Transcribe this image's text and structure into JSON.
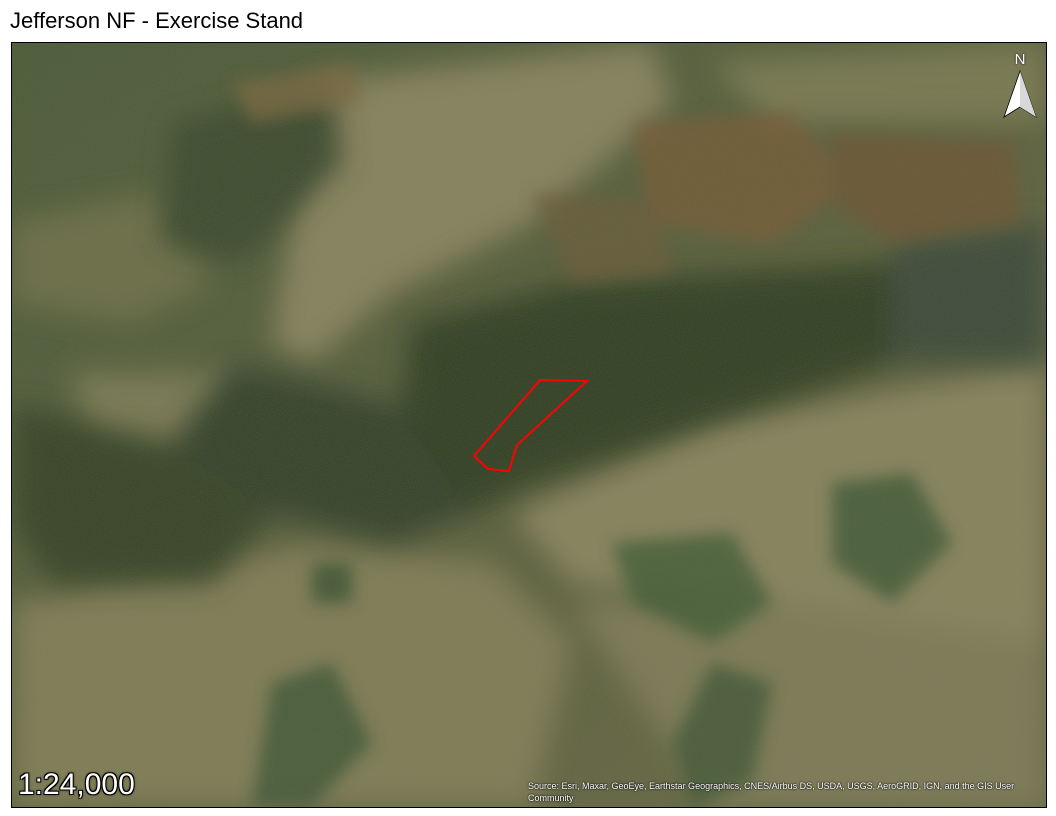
{
  "map": {
    "title": "Jefferson NF - Exercise Stand",
    "north_label": "N",
    "scale_label": "1:24,000",
    "attribution": "Source: Esri, Maxar, GeoEye, Earthstar Geographics, CNES/Airbus DS, USDA, USGS, AeroGRID, IGN, and the GIS User Community",
    "stand_outline_color": "#ff0000",
    "basemap": "satellite imagery",
    "icons": {
      "north": "north-arrow-icon"
    }
  }
}
